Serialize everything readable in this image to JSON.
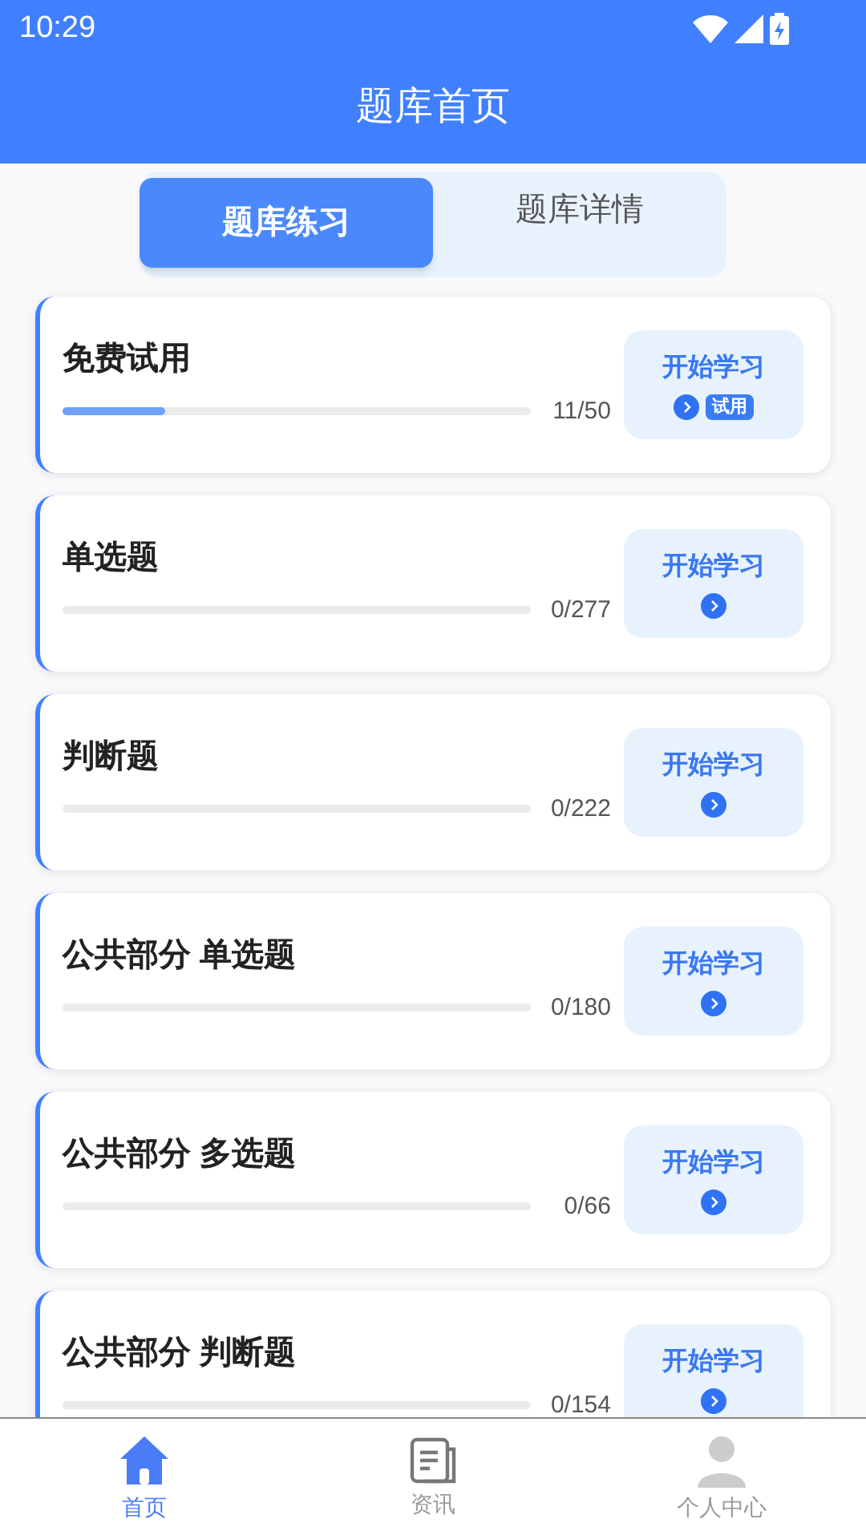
{
  "status_bar": {
    "time": "10:29"
  },
  "header": {
    "title": "题库首页"
  },
  "tabs": [
    {
      "label": "题库练习",
      "selected": true
    },
    {
      "label": "题库详情",
      "selected": false
    }
  ],
  "items": [
    {
      "title": "免费试用",
      "level": 0.22,
      "count": "11/50",
      "button": "开始学习",
      "badge": "试用"
    },
    {
      "title": "单选题",
      "count": "0/277",
      "button": "开始学习"
    },
    {
      "title": "判断题",
      "count": "0/222",
      "button": "开始学习"
    },
    {
      "title": "公共部分 单选题",
      "count": "0/180",
      "button": "开始学习"
    },
    {
      "title": "公共部分 多选题",
      "count": "0/66",
      "button": "开始学习"
    },
    {
      "title": "公共部分 判断题",
      "count": "0/154",
      "button": "开始学习"
    }
  ],
  "bottom_nav": [
    {
      "label": "首页",
      "kind": "home",
      "selected": true
    },
    {
      "label": "资讯",
      "kind": "news",
      "selected": false
    },
    {
      "label": "个人中心",
      "kind": "profile",
      "selected": false
    }
  ]
}
